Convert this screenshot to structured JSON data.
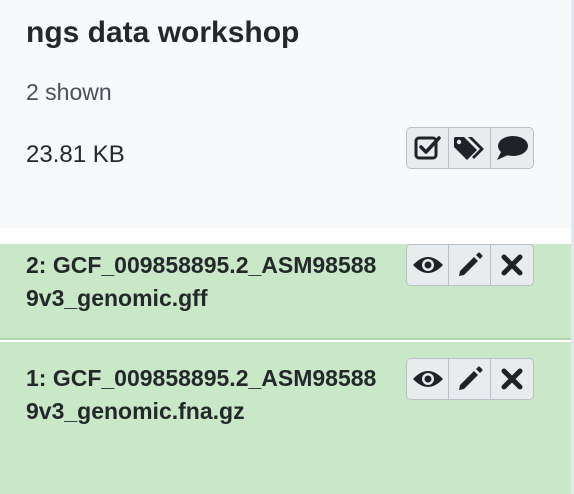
{
  "history": {
    "name": "ngs data workshop",
    "shown": "2 shown",
    "size": "23.81 KB",
    "actions": [
      {
        "icon": "check-square-icon",
        "label": "select items"
      },
      {
        "icon": "tags-icon",
        "label": "show tags"
      },
      {
        "icon": "comment-icon",
        "label": "show annotation"
      }
    ]
  },
  "datasets": [
    {
      "hid": 2,
      "title": "2: GCF_009858895.2_ASM985889v3_genomic.gff",
      "state_color": "#c9e8c7",
      "actions": [
        "eye-icon",
        "pencil-icon",
        "delete-icon"
      ]
    },
    {
      "hid": 1,
      "title": "1: GCF_009858895.2_ASM985889v3_genomic.fna.gz",
      "state_color": "#c9e8c7",
      "actions": [
        "eye-icon",
        "pencil-icon",
        "delete-icon"
      ]
    }
  ]
}
